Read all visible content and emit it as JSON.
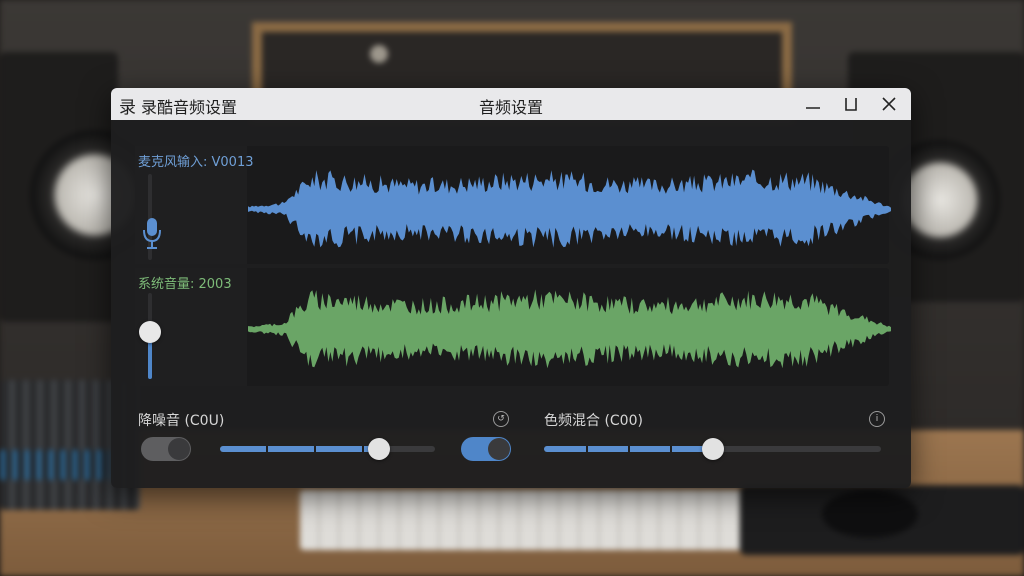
{
  "window": {
    "app_icon": "录",
    "app_name": "录酷音频设置",
    "title": "音频设置",
    "minimize_icon": "minimize-icon",
    "maximize_icon": "maximize-icon",
    "close_icon": "close-icon"
  },
  "tracks": [
    {
      "label": "麦克风输入: V0013",
      "color": "#5b8fd0",
      "level": 0.0,
      "icon": "microphone-icon"
    },
    {
      "label": "系统音量: 2003",
      "color": "#6aa566",
      "level": 0.55
    }
  ],
  "controls": {
    "noise": {
      "label": "降噪音 (C0U)",
      "enabled": false,
      "level": 0.74,
      "icon": "reset-icon"
    },
    "mix": {
      "label": "色频混合 (C00)",
      "enabled": true,
      "level": 0.5,
      "icon": "info-icon"
    }
  },
  "colors": {
    "accent": "#4f86c9",
    "track_mic": "#5b8fd0",
    "track_system": "#6aa566"
  }
}
